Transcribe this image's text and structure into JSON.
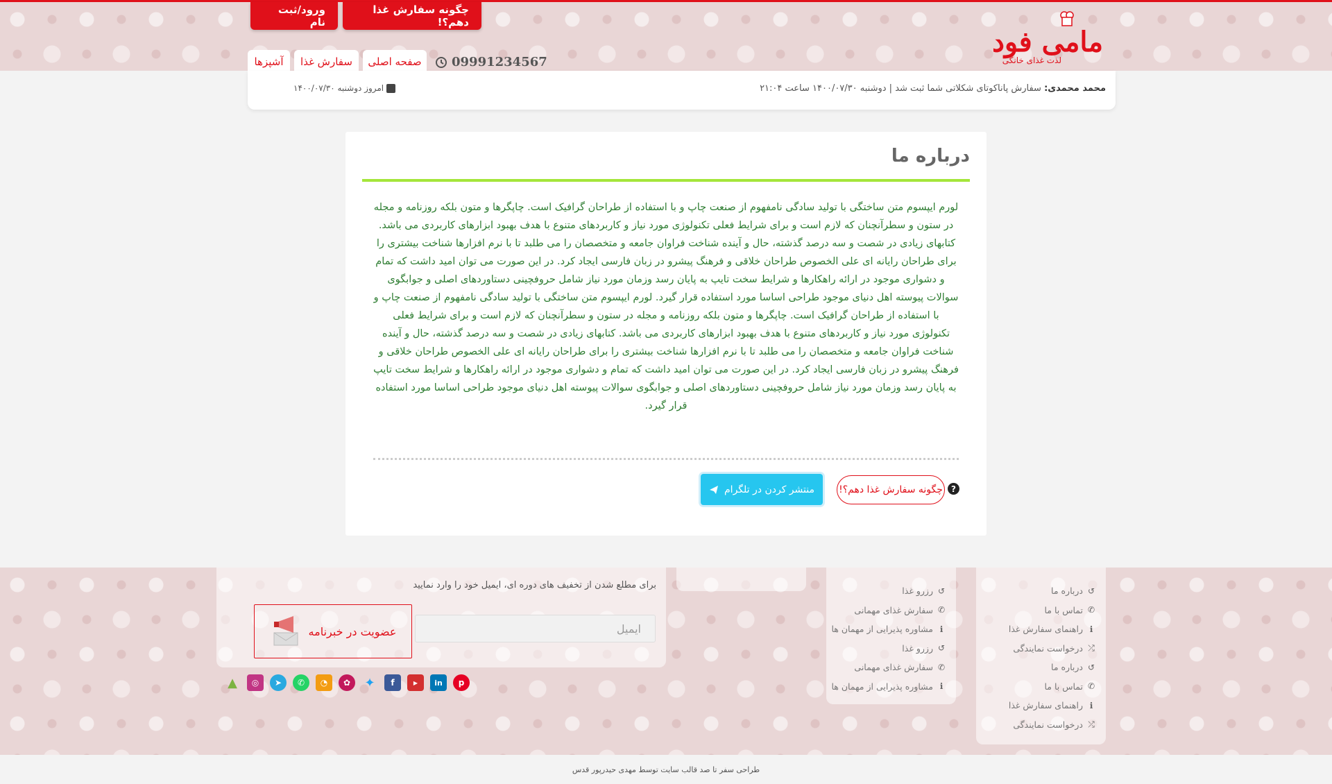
{
  "header": {
    "login_label": "ورود/ثبت نام",
    "howto_label": "چگونه سفارش غذا دهم؟!",
    "logo_text": "مامی فود",
    "logo_subtext": "لذت غذای خانگی",
    "phone": "09991234567",
    "nav": {
      "home": "صفحه اصلی",
      "order": "سفارش غذا",
      "chefs": "آشپزها"
    },
    "news_author": "محمد محمدی:",
    "news_text": "سفارش پاناکوتای شکلاتی شما ثبت شد | دوشنبه ۱۴۰۰/۰۷/۳۰ ساعت ۲۱:۰۴",
    "today": "امروز دوشنبه ۱۴۰۰/۰۷/۳۰"
  },
  "main": {
    "title": "درباره ما",
    "body": "لورم ایپسوم متن ساختگی با تولید سادگی نامفهوم از صنعت چاپ و با استفاده از طراحان گرافیک است. چاپگرها و متون بلکه روزنامه و مجله در ستون و سطرآنچنان که لازم است و برای شرایط فعلی تکنولوژی مورد نیاز و کاربردهای متنوع با هدف بهبود ابزارهای کاربردی می باشد. کتابهای زیادی در شصت و سه درصد گذشته، حال و آینده شناخت فراوان جامعه و متخصصان را می طلبد تا با نرم افزارها شناخت بیشتری را برای طراحان رایانه ای علی الخصوص طراحان خلاقی و فرهنگ پیشرو در زبان فارسی ایجاد کرد. در این صورت می توان امید داشت که تمام و دشواری موجود در ارائه راهکارها و شرایط سخت تایپ به پایان رسد وزمان مورد نیاز شامل حروفچینی دستاوردهای اصلی و جوابگوی سوالات پیوسته اهل دنیای موجود طراحی اساسا مورد استفاده قرار گیرد. لورم ایپسوم متن ساختگی با تولید سادگی نامفهوم از صنعت چاپ و با استفاده از طراحان گرافیک است. چاپگرها و متون بلکه روزنامه و مجله در ستون و سطرآنچنان که لازم است و برای شرایط فعلی تکنولوژی مورد نیاز و کاربردهای متنوع با هدف بهبود ابزارهای کاربردی می باشد. کتابهای زیادی در شصت و سه درصد گذشته، حال و آینده شناخت فراوان جامعه و متخصصان را می طلبد تا با نرم افزارها شناخت بیشتری را برای طراحان رایانه ای علی الخصوص طراحان خلاقی و فرهنگ پیشرو در زبان فارسی ایجاد کرد. در این صورت می توان امید داشت که تمام و دشواری موجود در ارائه راهکارها و شرایط سخت تایپ به پایان رسد وزمان مورد نیاز شامل حروفچینی دستاوردهای اصلی و جوابگوی سوالات پیوسته اهل دنیای موجود طراحی اساسا مورد استفاده قرار گیرد.",
    "telegram_label": "منتشر کردن در تلگرام",
    "howto_label": "چگونه سفارش غذا دهم؟!",
    "help_icon": "question-circle-icon"
  },
  "footer": {
    "links_col1": [
      {
        "icon": "history-icon",
        "label": "درباره ما"
      },
      {
        "icon": "phone-icon",
        "label": "تماس با ما"
      },
      {
        "icon": "info-icon",
        "label": "راهنمای سفارش غذا"
      },
      {
        "icon": "shuffle-icon",
        "label": "درخواست نمایندگی"
      },
      {
        "icon": "history-icon",
        "label": "درباره ما"
      },
      {
        "icon": "phone-icon",
        "label": "تماس با ما"
      },
      {
        "icon": "info-icon",
        "label": "راهنمای سفارش غذا"
      },
      {
        "icon": "shuffle-icon",
        "label": "درخواست نمایندگی"
      }
    ],
    "links_col2": [
      {
        "icon": "history-icon",
        "label": "رزرو غذا"
      },
      {
        "icon": "phone-icon",
        "label": "سفارش غذای مهمانی"
      },
      {
        "icon": "info-icon",
        "label": "مشاوره پذیرایی از مهمان ها"
      },
      {
        "icon": "history-icon",
        "label": "رزرو غذا"
      },
      {
        "icon": "phone-icon",
        "label": "سفارش غذای مهمانی"
      },
      {
        "icon": "info-icon",
        "label": "مشاوره پذیرایی از مهمان ها"
      }
    ],
    "newsletter_text": "برای مطلع شدن از تخفیف های دوره ای، ایمیل خود را وارد نمایید",
    "email_placeholder": "ایمیل",
    "subscribe_label": "عضویت در خبرنامه",
    "socials": [
      "android-icon",
      "instagram-icon",
      "telegram-icon",
      "whatsapp-icon",
      "rss-icon",
      "flickr-icon",
      "twitter-icon",
      "facebook-icon",
      "youtube-icon",
      "linkedin-icon",
      "pinterest-icon"
    ],
    "copyright": "طراحی سفر تا صد قالب سایت توسط مهدی حیدرپور قدس"
  },
  "colors": {
    "brand_red": "#e0101a",
    "accent_green": "#a4e63a",
    "text_green": "#2e7d32",
    "telegram_blue": "#26c6ef"
  }
}
